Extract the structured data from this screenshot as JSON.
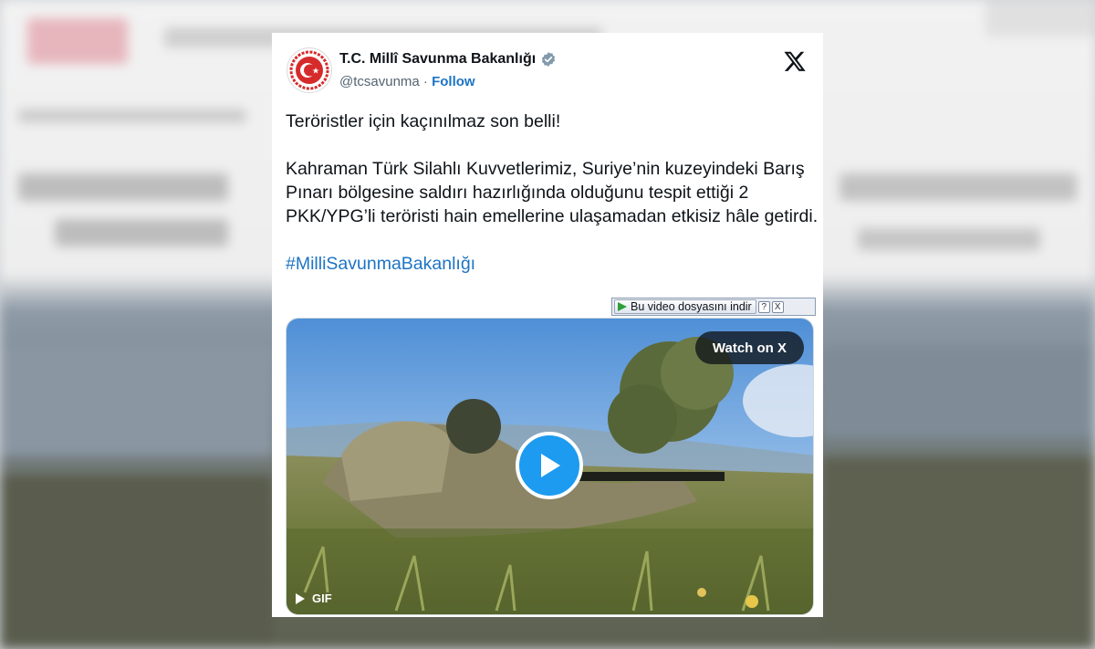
{
  "tweet": {
    "author_name": "T.C. Millî Savunma Bakanlığı",
    "handle": "@tcsavunma",
    "separator": " · ",
    "follow_label": "Follow",
    "paragraph_1": "Teröristler için kaçınılmaz son belli!",
    "paragraph_2": "Kahraman Türk Silahlı Kuvvetlerimiz, Suriye’nin kuzeyindeki Barış Pınarı bölgesine saldırı hazırlığında olduğunu tespit ettiği 2 PKK/YPG’li teröristi hain emellerine ulaşamadan etkisiz hâle getirdi.",
    "hashtag": "#MilliSavunmaBakanlığı"
  },
  "media": {
    "watch_label": "Watch on X",
    "badge_label": "GIF"
  },
  "download_bar": {
    "label": "Bu video dosyasını indir",
    "help": "?",
    "close": "X"
  },
  "icons": {
    "avatar": "ministry-emblem-icon",
    "verified": "verified-badge-icon",
    "platform": "x-logo-icon",
    "play": "play-icon",
    "gif": "play-small-icon"
  },
  "colors": {
    "link": "#1d74c4",
    "play_button": "#1d9bf0",
    "verified": "#829aab",
    "emblem_red": "#d62b2b"
  }
}
